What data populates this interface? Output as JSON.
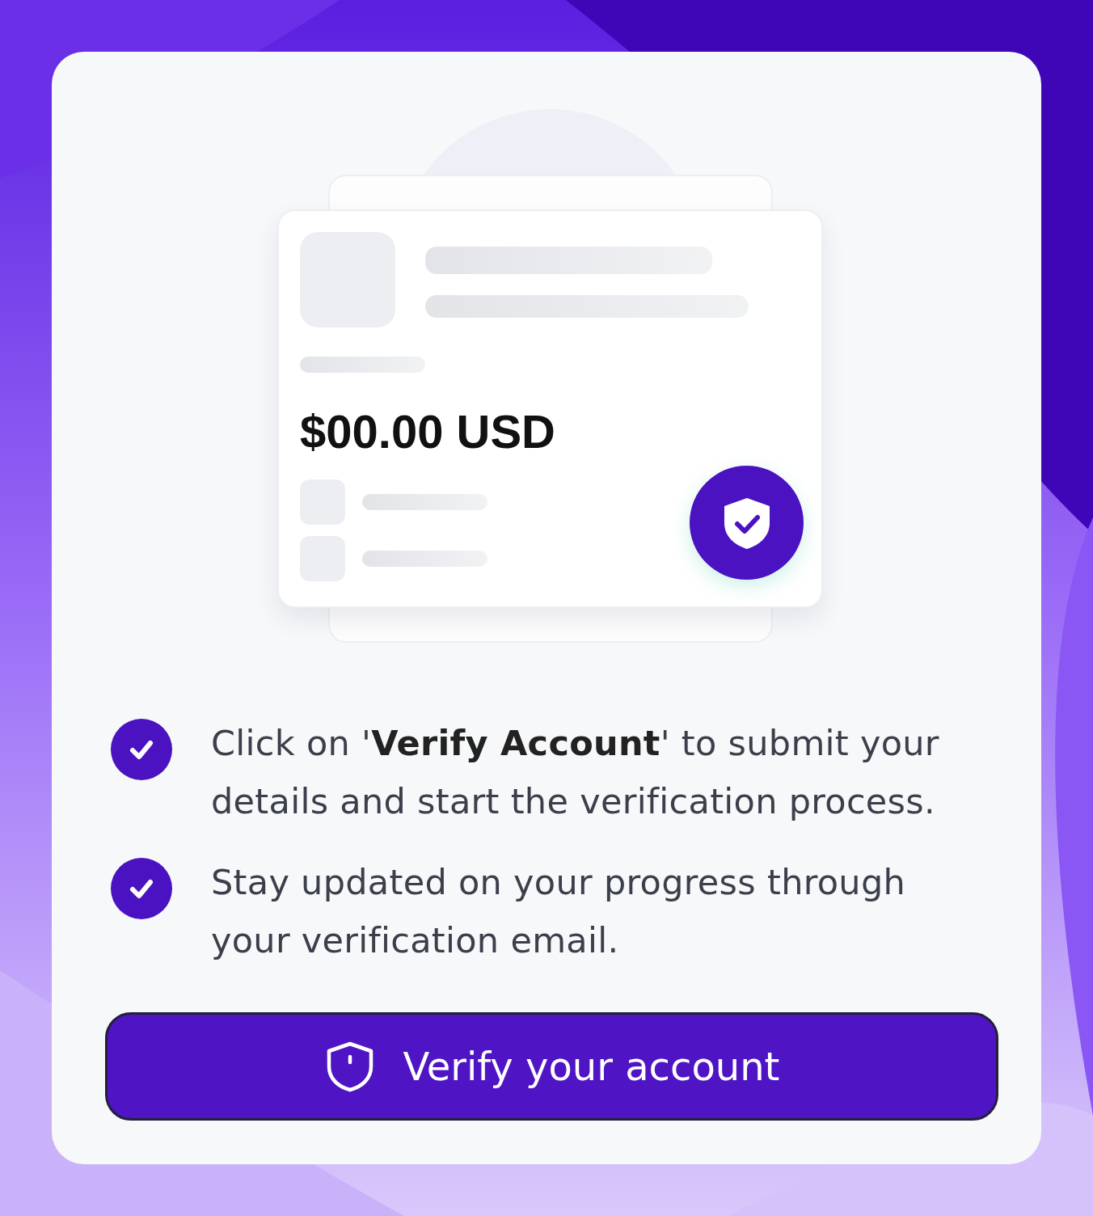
{
  "amount": "$00.00 USD",
  "steps": [
    {
      "text": "Click on '**Verify Account**' to submit your details and start the verification process.",
      "checked": true
    },
    {
      "text": "Stay updated on your progress through your verification email.",
      "checked": true
    }
  ],
  "button": {
    "label": "Verify your account"
  }
}
